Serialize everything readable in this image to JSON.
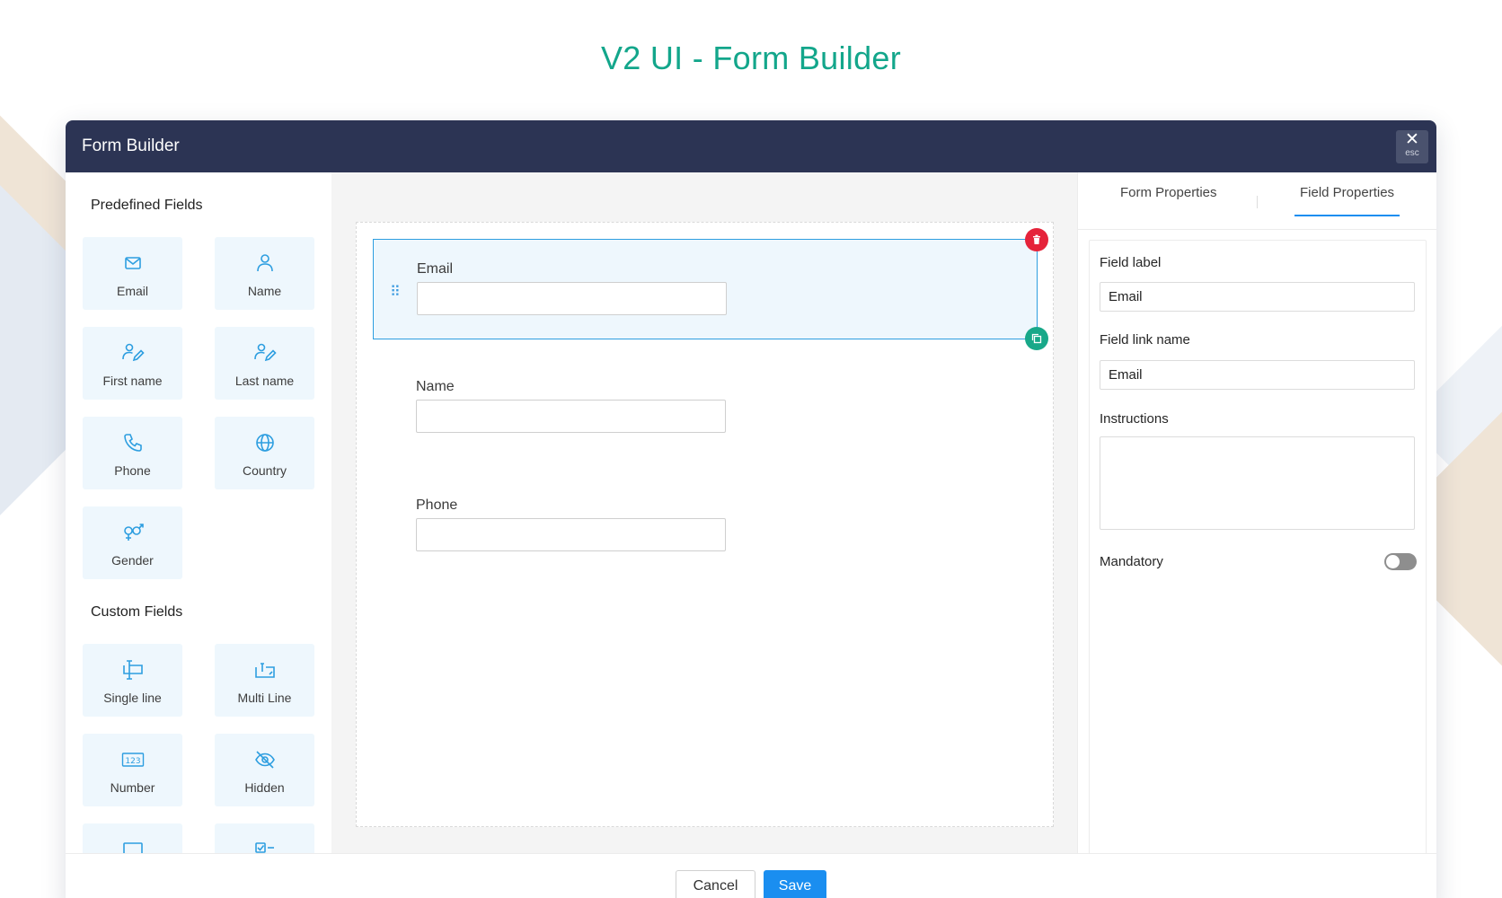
{
  "page_title": "V2 UI - Form Builder",
  "window": {
    "title": "Form Builder",
    "close_label": "esc"
  },
  "palette": {
    "predefined_title": "Predefined Fields",
    "predefined": [
      {
        "label": "Email",
        "icon": "envelope-icon"
      },
      {
        "label": "Name",
        "icon": "person-icon"
      },
      {
        "label": "First name",
        "icon": "person-edit-icon"
      },
      {
        "label": "Last name",
        "icon": "person-edit-icon"
      },
      {
        "label": "Phone",
        "icon": "phone-icon"
      },
      {
        "label": "Country",
        "icon": "globe-icon"
      },
      {
        "label": "Gender",
        "icon": "gender-icon"
      }
    ],
    "custom_title": "Custom Fields",
    "custom": [
      {
        "label": "Single line",
        "icon": "single-line-icon"
      },
      {
        "label": "Multi Line",
        "icon": "multi-line-icon"
      },
      {
        "label": "Number",
        "icon": "number-icon"
      },
      {
        "label": "Hidden",
        "icon": "eye-off-icon"
      }
    ]
  },
  "canvas": {
    "fields": [
      {
        "label": "Email",
        "selected": true
      },
      {
        "label": "Name",
        "selected": false
      },
      {
        "label": "Phone",
        "selected": false
      }
    ]
  },
  "properties": {
    "tabs": [
      "Form Properties",
      "Field Properties"
    ],
    "active_tab": "Field Properties",
    "field_label_label": "Field label",
    "field_label_value": "Email",
    "field_link_name_label": "Field link name",
    "field_link_name_value": "Email",
    "instructions_label": "Instructions",
    "mandatory_label": "Mandatory",
    "mandatory": false
  },
  "footer": {
    "cancel_label": "Cancel",
    "save_label": "Save"
  },
  "colors": {
    "title_green": "#13a68b",
    "header_navy": "#2c3454",
    "accent_blue": "#1a8ef0",
    "delete_red": "#e5233a",
    "copy_green": "#18a889"
  }
}
